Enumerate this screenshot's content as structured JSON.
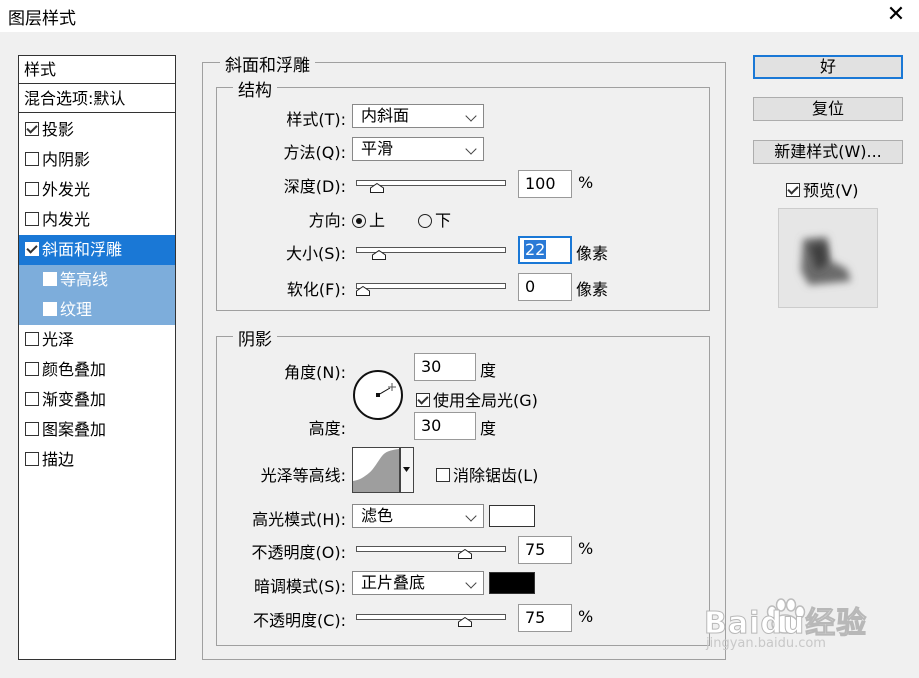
{
  "window": {
    "title": "图层样式",
    "close_glyph": "✕"
  },
  "style_list": {
    "header": "样式",
    "blend_options": "混合选项:默认",
    "items": [
      {
        "label": "投影",
        "checked": true
      },
      {
        "label": "内阴影",
        "checked": false
      },
      {
        "label": "外发光",
        "checked": false
      },
      {
        "label": "内发光",
        "checked": false
      },
      {
        "label": "斜面和浮雕",
        "checked": true,
        "selected": true
      },
      {
        "label": "等高线",
        "checked": false,
        "sub": true
      },
      {
        "label": "纹理",
        "checked": false,
        "sub": true
      },
      {
        "label": "光泽",
        "checked": false
      },
      {
        "label": "颜色叠加",
        "checked": false
      },
      {
        "label": "渐变叠加",
        "checked": false
      },
      {
        "label": "图案叠加",
        "checked": false
      },
      {
        "label": "描边",
        "checked": false
      }
    ]
  },
  "bevel": {
    "title": "斜面和浮雕",
    "structure": {
      "title": "结构",
      "style_label": "样式(T):",
      "style_value": "内斜面",
      "technique_label": "方法(Q):",
      "technique_value": "平滑",
      "depth_label": "深度(D):",
      "depth_value": "100",
      "depth_unit": "%",
      "depth_level": 0.1,
      "direction_label": "方向:",
      "dir_up": "上",
      "dir_down": "下",
      "direction_selected": "上",
      "size_label": "大小(S):",
      "size_value": "22",
      "size_unit": "像素",
      "size_level": 0.12,
      "soften_label": "软化(F):",
      "soften_value": "0",
      "soften_unit": "像素",
      "soften_level": 0.0
    },
    "shading": {
      "title": "阴影",
      "angle_label": "角度(N):",
      "angle_value": "30",
      "angle_unit": "度",
      "global_light_label": "使用全局光(G)",
      "global_light_checked": true,
      "altitude_label": "高度:",
      "altitude_value": "30",
      "altitude_unit": "度",
      "gloss_contour_label": "光泽等高线:",
      "antialias_label": "消除锯齿(L)",
      "antialias_checked": false,
      "highlight_mode_label": "高光模式(H):",
      "highlight_mode_value": "滤色",
      "highlight_color": "#ffffff",
      "highlight_opacity_label": "不透明度(O):",
      "highlight_opacity_value": "75",
      "highlight_opacity_unit": "%",
      "highlight_opacity_level": 0.75,
      "shadow_mode_label": "暗调模式(S):",
      "shadow_mode_value": "正片叠底",
      "shadow_color": "#000000",
      "shadow_opacity_label": "不透明度(C):",
      "shadow_opacity_value": "75",
      "shadow_opacity_unit": "%",
      "shadow_opacity_level": 0.75
    }
  },
  "buttons": {
    "ok": "好",
    "reset": "复位",
    "new_style": "新建样式(W)...",
    "preview_label": "预览(V)",
    "preview_checked": true
  },
  "colors": {
    "accent": "#1a78d6",
    "selected_row": "#1a78d6",
    "sub_row": "#7daddb"
  },
  "watermark": {
    "brand": "Baidu经验",
    "url": "jingyan.baidu.com"
  }
}
